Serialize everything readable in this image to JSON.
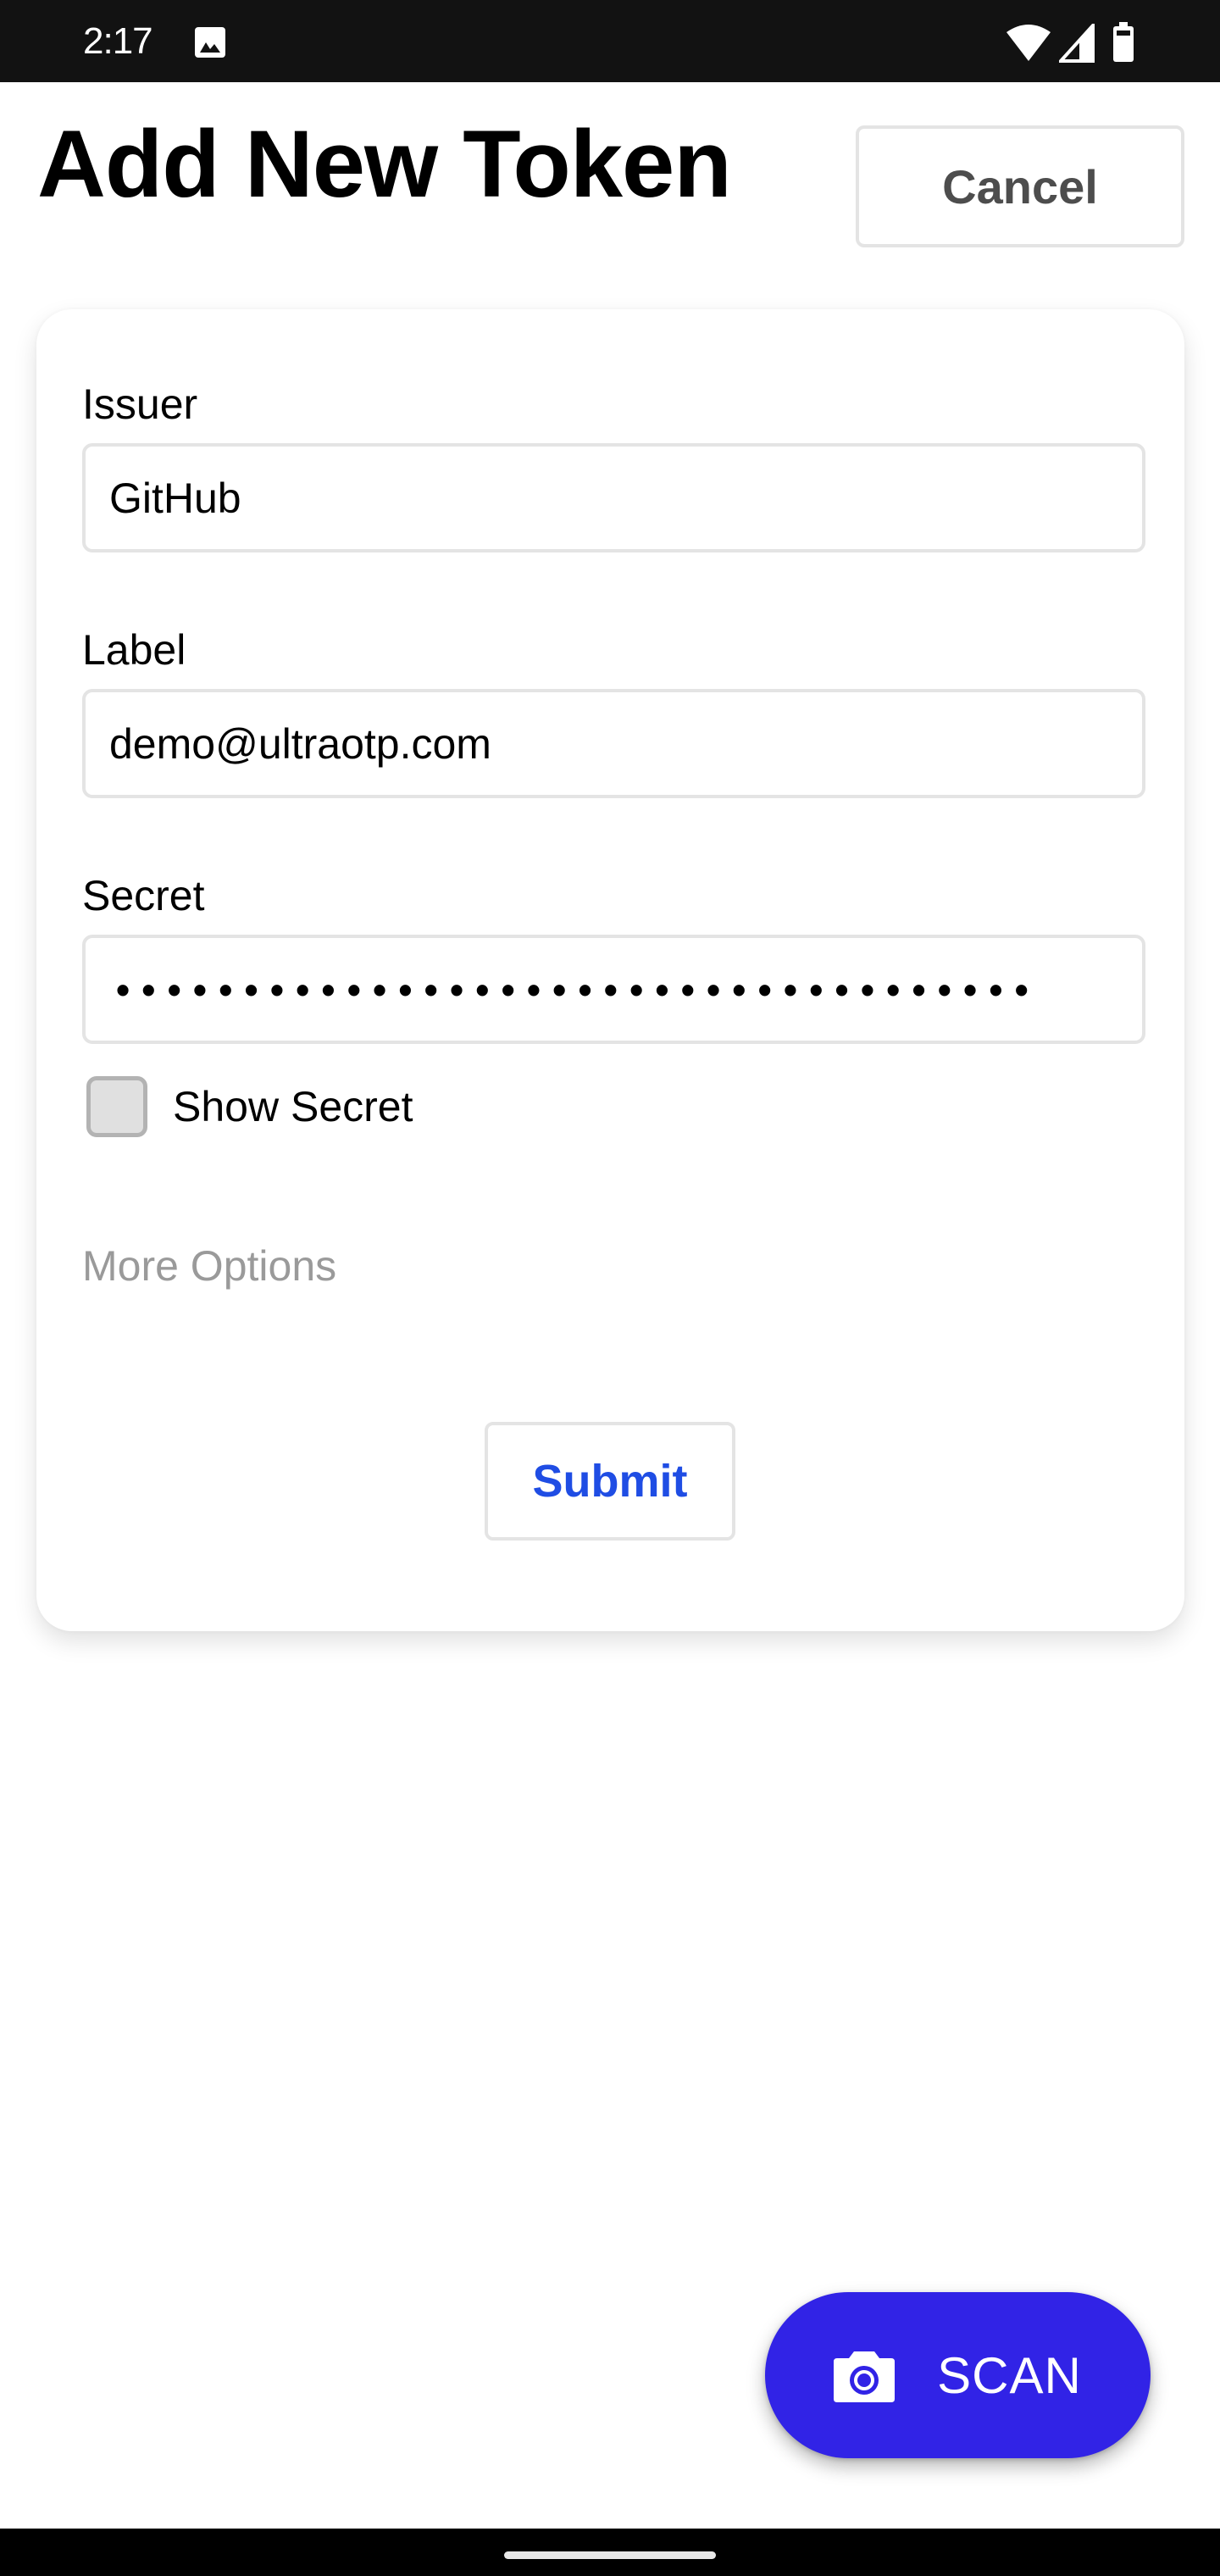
{
  "status_bar": {
    "time": "2:17",
    "icons": [
      "image-notification-icon",
      "wifi-icon",
      "cell-signal-icon",
      "battery-icon"
    ]
  },
  "header": {
    "title": "Add New Token",
    "cancel_label": "Cancel"
  },
  "form": {
    "issuer": {
      "label": "Issuer",
      "value": "GitHub"
    },
    "label": {
      "label": "Label",
      "value": "demo@ultraotp.com"
    },
    "secret": {
      "label": "Secret",
      "masked_value": "••••••••••••••••••••••••••••••••••••"
    },
    "show_secret": {
      "label": "Show Secret",
      "checked": false
    },
    "more_options_label": "More Options",
    "submit_label": "Submit"
  },
  "fab": {
    "label": "SCAN",
    "icon": "camera-icon"
  },
  "colors": {
    "accent": "#3123E6",
    "submit_text": "#1F4DE4",
    "muted_text": "#9A9A9A",
    "status_bar_bg": "#121212"
  }
}
